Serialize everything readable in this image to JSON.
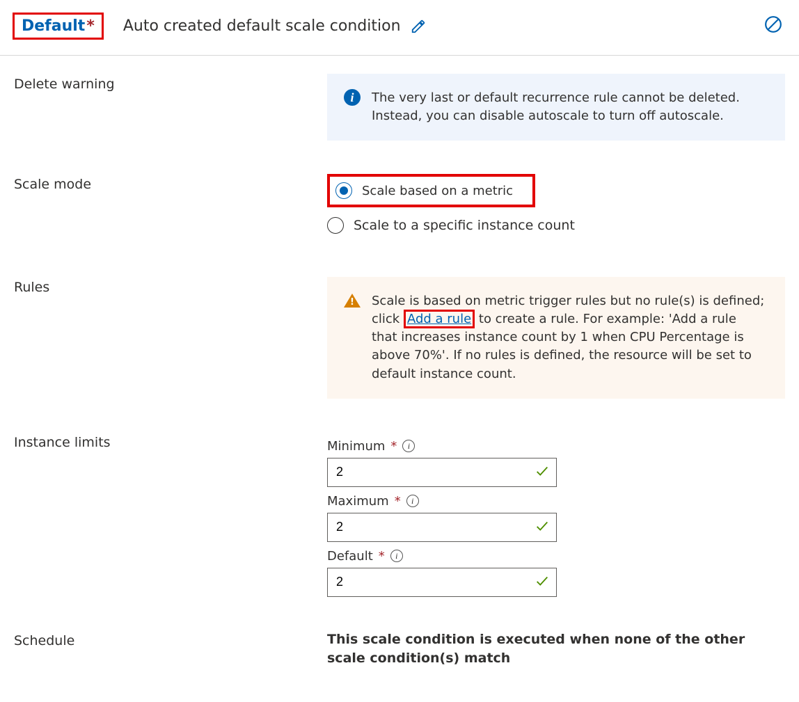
{
  "header": {
    "badge_label": "Default",
    "title": "Auto created default scale condition"
  },
  "sections": {
    "delete_warning": {
      "label": "Delete warning",
      "message": "The very last or default recurrence rule cannot be deleted. Instead, you can disable autoscale to turn off autoscale."
    },
    "scale_mode": {
      "label": "Scale mode",
      "option_metric": "Scale based on a metric",
      "option_count": "Scale to a specific instance count"
    },
    "rules": {
      "label": "Rules",
      "msg_before": "Scale is based on metric trigger rules but no rule(s) is defined; click ",
      "link_text": "Add a rule",
      "msg_after": " to create a rule. For example: 'Add a rule that increases instance count by 1 when CPU Percentage is above 70%'. If no rules is defined, the resource will be set to default instance count."
    },
    "instance_limits": {
      "label": "Instance limits",
      "minimum_label": "Minimum",
      "minimum_value": "2",
      "maximum_label": "Maximum",
      "maximum_value": "2",
      "default_label": "Default",
      "default_value": "2"
    },
    "schedule": {
      "label": "Schedule",
      "note": "This scale condition is executed when none of the other scale condition(s) match"
    }
  }
}
